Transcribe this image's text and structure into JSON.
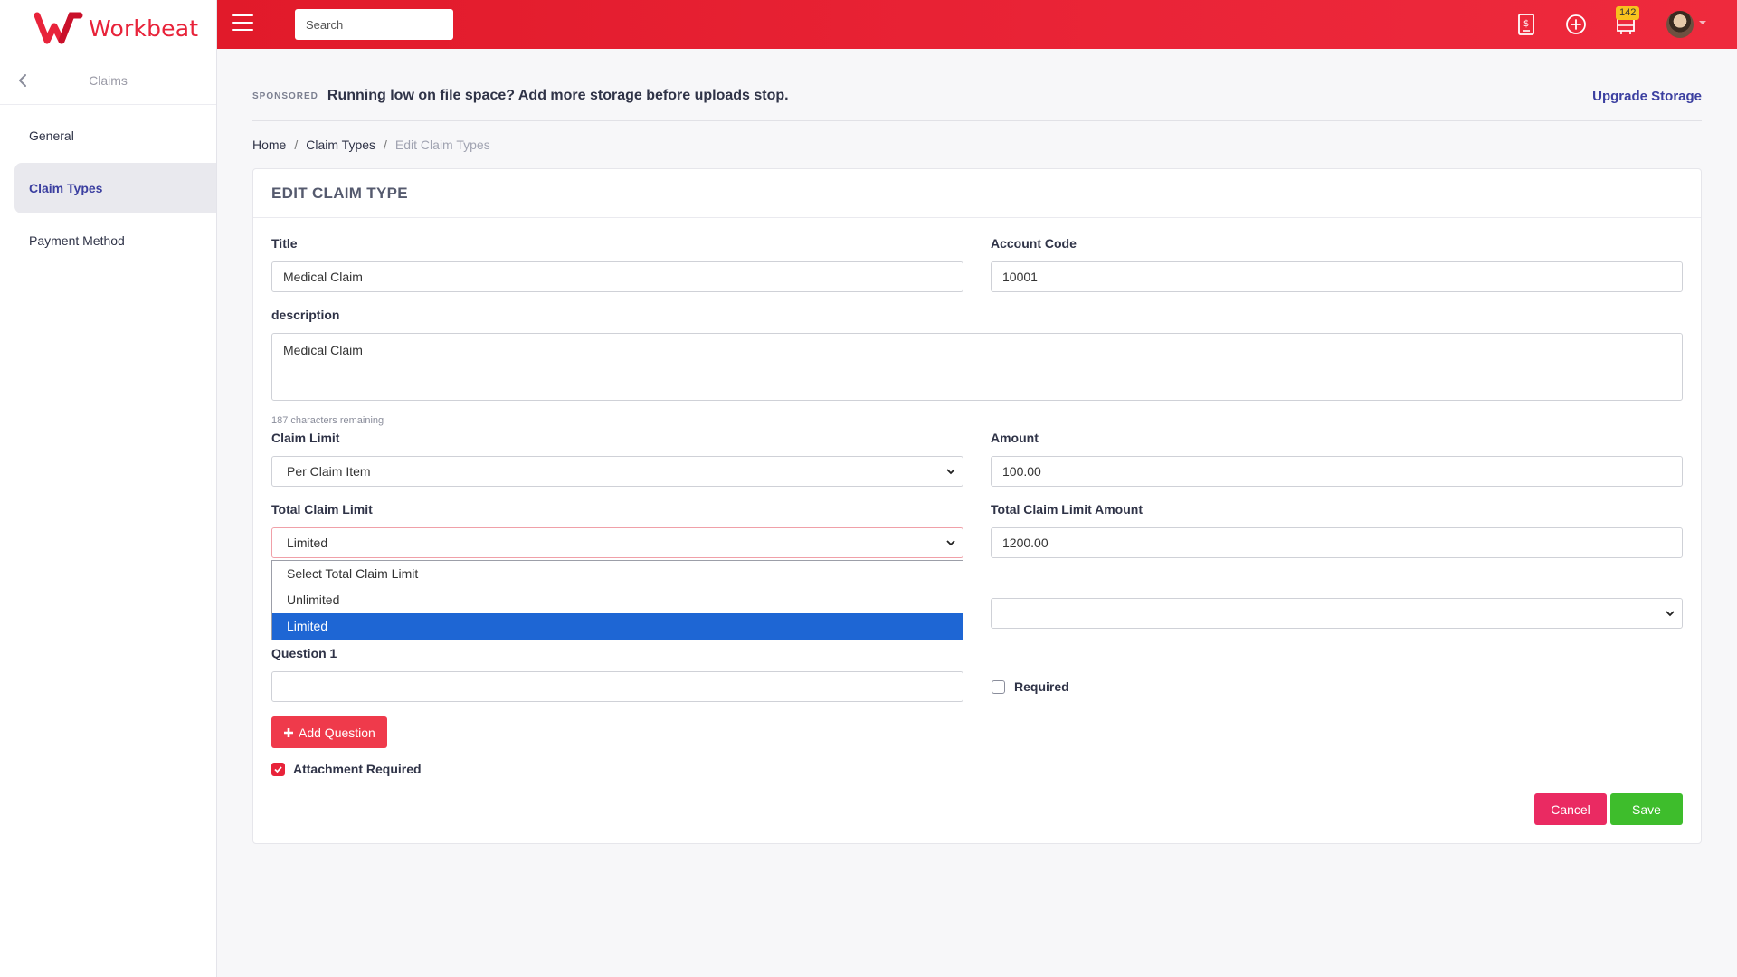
{
  "app": {
    "name": "Workbeat"
  },
  "sidebar": {
    "title": "Claims",
    "items": [
      {
        "label": "General"
      },
      {
        "label": "Claim Types"
      },
      {
        "label": "Payment Method"
      }
    ]
  },
  "topbar": {
    "search_placeholder": "Search",
    "notification_count": "142"
  },
  "sponsored": {
    "label": "SPONSORED",
    "text": "Running low on file space? Add more storage before uploads stop.",
    "link": "Upgrade Storage"
  },
  "breadcrumb": {
    "home": "Home",
    "section": "Claim Types",
    "current": "Edit Claim Types"
  },
  "form": {
    "header": "EDIT CLAIM TYPE",
    "title_label": "Title",
    "title_value": "Medical Claim",
    "account_code_label": "Account Code",
    "account_code_value": "10001",
    "description_label": "description",
    "description_value": "Medical Claim",
    "chars_remaining": "187 characters remaining",
    "claim_limit_label": "Claim Limit",
    "claim_limit_value": "Per Claim Item",
    "amount_label": "Amount",
    "amount_value": "100.00",
    "total_claim_limit_label": "Total Claim Limit",
    "total_claim_limit_value": "Limited",
    "total_claim_limit_options": [
      "Select Total Claim Limit",
      "Unlimited",
      "Limited"
    ],
    "total_claim_limit_amount_label": "Total Claim Limit Amount",
    "total_claim_limit_amount_value": "1200.00",
    "question1_label": "Question 1",
    "question1_value": "",
    "required_label": "Required",
    "required_checked": false,
    "add_question_label": "Add Question",
    "attachment_required_label": "Attachment Required",
    "attachment_required_checked": true,
    "cancel_label": "Cancel",
    "save_label": "Save"
  }
}
